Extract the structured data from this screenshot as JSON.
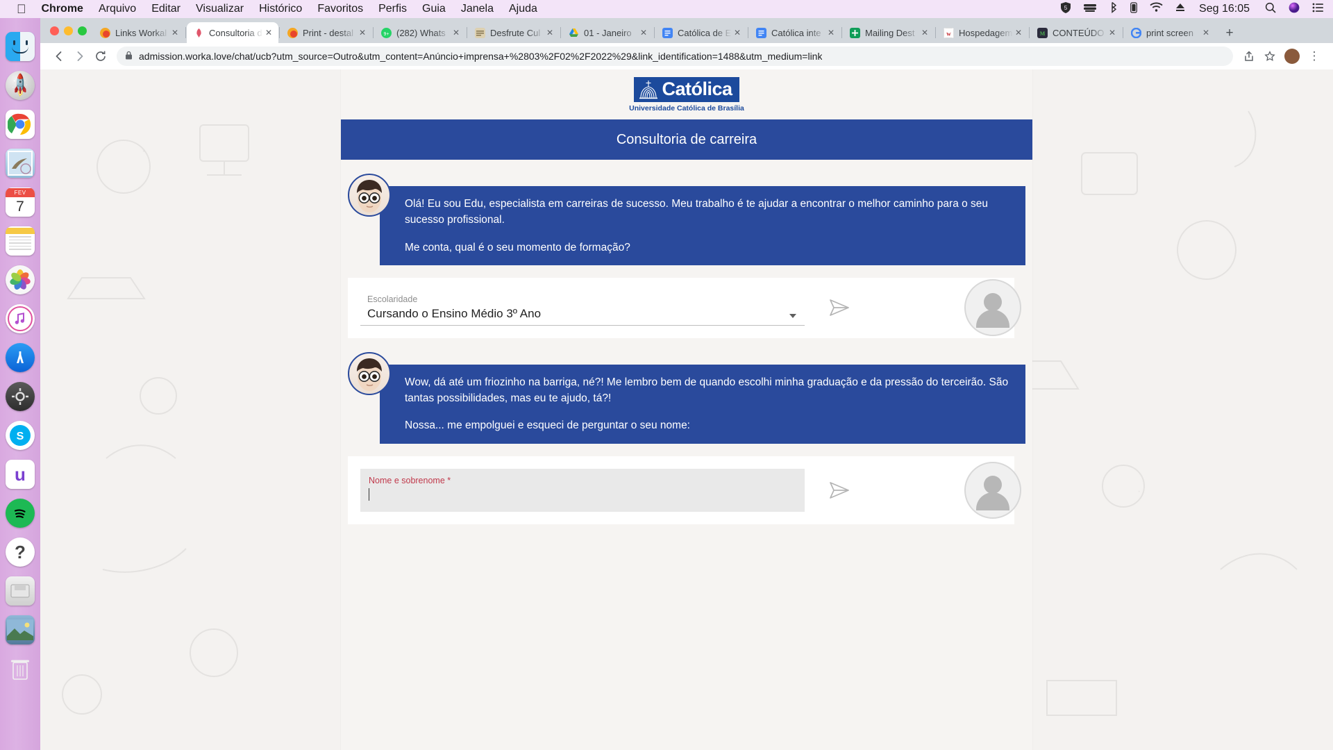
{
  "menubar": {
    "apple": "",
    "items": [
      {
        "label": "Chrome",
        "bold": true
      },
      {
        "label": "Arquivo",
        "bold": false
      },
      {
        "label": "Editar",
        "bold": false
      },
      {
        "label": "Visualizar",
        "bold": false
      },
      {
        "label": "Histórico",
        "bold": false
      },
      {
        "label": "Favoritos",
        "bold": false
      },
      {
        "label": "Perfis",
        "bold": false
      },
      {
        "label": "Guia",
        "bold": false
      },
      {
        "label": "Janela",
        "bold": false
      },
      {
        "label": "Ajuda",
        "bold": false
      }
    ],
    "status_icons": [
      "shield-icon",
      "battery-stack-icon",
      "bluetooth-icon",
      "wifi-icon",
      "eject-icon"
    ],
    "clock": "Seg 16:05",
    "right_icons": [
      "search-icon",
      "siri-icon",
      "control-center-icon"
    ]
  },
  "dock": {
    "items": [
      {
        "name": "finder",
        "label": "Finder",
        "running": true
      },
      {
        "name": "launchpad",
        "label": "Launchpad",
        "running": false
      },
      {
        "name": "chrome",
        "label": "Google Chrome",
        "running": true
      },
      {
        "name": "mail",
        "label": "Mail",
        "running": false
      },
      {
        "name": "calendar",
        "label": "Calendário",
        "month": "FEV",
        "day": "7",
        "running": false
      },
      {
        "name": "notes",
        "label": "Notas",
        "running": false
      },
      {
        "name": "photos",
        "label": "Fotos",
        "running": false
      },
      {
        "name": "itunes",
        "label": "iTunes",
        "running": false
      },
      {
        "name": "appstore",
        "label": "App Store",
        "running": false
      },
      {
        "name": "system-preferences",
        "label": "Preferências do Sistema",
        "running": false
      },
      {
        "name": "skype",
        "label": "Skype",
        "running": false
      },
      {
        "name": "umbler",
        "label": "Umbler",
        "running": false
      },
      {
        "name": "spotify",
        "label": "Spotify",
        "running": false
      },
      {
        "name": "help",
        "label": "Ajuda",
        "running": false
      },
      {
        "name": "disk-image",
        "label": "Imagem de disco",
        "running": false
      },
      {
        "name": "screenshot",
        "label": "Captura de tela",
        "running": false
      },
      {
        "name": "trash",
        "label": "Lixo",
        "running": false
      }
    ]
  },
  "browser": {
    "tabs": [
      {
        "title": "Links Workal",
        "favicon": "rocket",
        "active": false
      },
      {
        "title": "Consultoria d",
        "favicon": "rocket-pink",
        "active": true
      },
      {
        "title": "Print - destal",
        "favicon": "rocket",
        "active": false
      },
      {
        "title": "(282) Whats",
        "favicon": "whatsapp",
        "active": false
      },
      {
        "title": "Desfrute Cul",
        "favicon": "news",
        "active": false
      },
      {
        "title": "01 - Janeiro",
        "favicon": "drive",
        "active": false
      },
      {
        "title": "Católica de E",
        "favicon": "docs",
        "active": false
      },
      {
        "title": "Católica inte",
        "favicon": "docs",
        "active": false
      },
      {
        "title": "Mailing Dest",
        "favicon": "sheets",
        "active": false
      },
      {
        "title": "Hospedagem",
        "favicon": "wordpress",
        "active": false
      },
      {
        "title": "CONTEÚDO",
        "favicon": "mailchimp",
        "active": false
      },
      {
        "title": "print screen",
        "favicon": "google",
        "active": false
      }
    ],
    "new_tab_label": "+",
    "nav": {
      "back": "‹",
      "forward": "›",
      "reload": "⟳",
      "share": "share-icon",
      "bookmark": "star-icon",
      "menu": "⋮",
      "profile_initial": ""
    },
    "omnibox": {
      "lock": "lock-icon",
      "url": "admission.worka.love/chat/ucb?utm_source=Outro&utm_content=Anúncio+imprensa+%2803%2F02%2F2022%29&link_identification=1488&utm_medium=link"
    }
  },
  "page": {
    "brand": {
      "wordmark": "Católica",
      "subtitle": "Universidade Católica de Brasília"
    },
    "header_title": "Consultoria de carreira",
    "messages": [
      {
        "sender": "bot",
        "paragraphs": [
          "Olá! Eu sou Edu, especialista em carreiras de sucesso. Meu trabalho é te ajudar a encontrar o melhor caminho para o seu sucesso profissional.",
          "Me conta, qual é o seu momento de formação?"
        ]
      },
      {
        "sender": "bot",
        "paragraphs": [
          "Wow, dá até um friozinho na barriga, né?! Me lembro bem de quando escolhi minha graduação e da pressão do terceirão. São tantas possibilidades, mas eu te ajudo, tá?!",
          "Nossa... me empolguei e esqueci de perguntar o seu nome:"
        ]
      }
    ],
    "inputs": [
      {
        "kind": "select",
        "label": "Escolaridade",
        "value": "Cursando o Ensino Médio 3º Ano",
        "required": false,
        "send_label": "send-icon"
      },
      {
        "kind": "text",
        "label": "Nome e sobrenome *",
        "value": "",
        "placeholder": "",
        "required": true,
        "send_label": "send-icon"
      }
    ],
    "colors": {
      "brand_blue": "#2a4a9c",
      "logo_blue": "#1c4a9c",
      "required_red": "#c0394b",
      "page_bg": "#f5f3f1",
      "card_bg": "#ffffff"
    }
  }
}
